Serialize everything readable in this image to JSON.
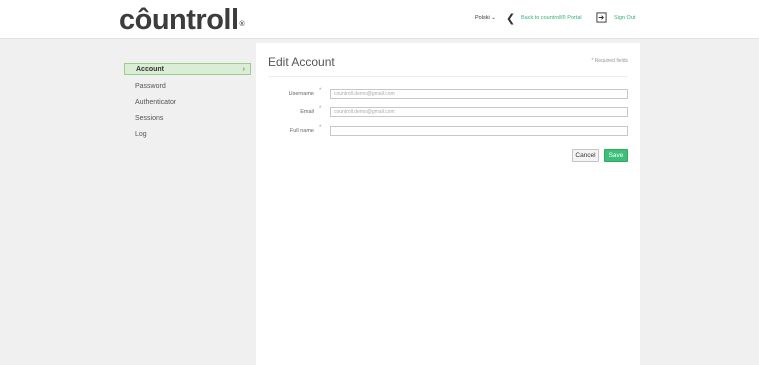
{
  "header": {
    "logo_text": "côuntroll",
    "language": "Polski ⌄",
    "back_label": "Back to countroll® Portal",
    "signout_label": "Sign Out"
  },
  "sidebar": {
    "items": [
      {
        "label": "Account",
        "active": true
      },
      {
        "label": "Password",
        "active": false
      },
      {
        "label": "Authenticator",
        "active": false
      },
      {
        "label": "Sessions",
        "active": false
      },
      {
        "label": "Log",
        "active": false
      }
    ]
  },
  "form": {
    "title": "Edit Account",
    "required_note": "* Required fields",
    "fields": [
      {
        "label": "Username",
        "value": "countroll.demo@gmail.com"
      },
      {
        "label": "Email",
        "value": "countroll.demo@gmail.com"
      },
      {
        "label": "Full name",
        "value": ""
      }
    ],
    "cancel_label": "Cancel",
    "save_label": "Save"
  },
  "colors": {
    "accent": "#35b274",
    "save_button": "#3cc079",
    "active_item_bg": "#d9eed4"
  }
}
